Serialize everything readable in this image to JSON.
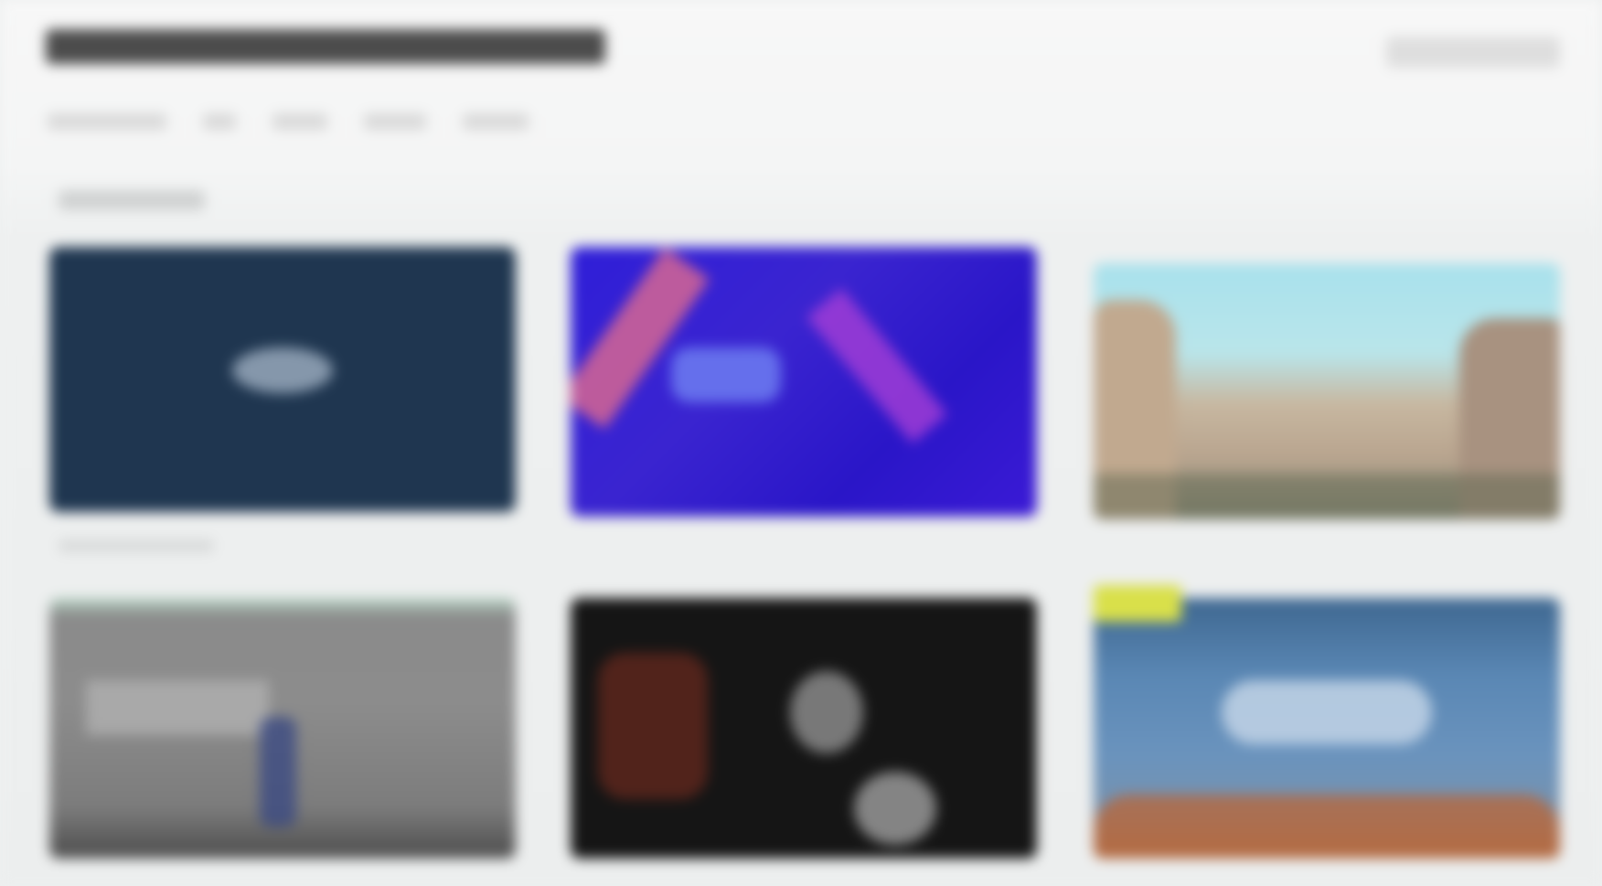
{
  "header": {
    "title": "",
    "action_label": ""
  },
  "tabs": [
    {
      "label": ""
    },
    {
      "label": ""
    },
    {
      "label": ""
    },
    {
      "label": ""
    },
    {
      "label": ""
    }
  ],
  "section": {
    "label": ""
  },
  "cards": [
    {
      "caption": "",
      "theme": "dark navy",
      "accent": "#1f3650"
    },
    {
      "caption": "",
      "theme": "vivid blue-purple",
      "accent": "#3a24d0"
    },
    {
      "caption": "",
      "theme": "coastal rocks and sky",
      "accent": "#a8e1ec"
    },
    {
      "caption": "",
      "theme": "grey street",
      "accent": "#8c8c8c"
    },
    {
      "caption": "",
      "theme": "dark night",
      "accent": "#151515"
    },
    {
      "caption": "",
      "theme": "blue sky with red rocks",
      "accent": "#5a87b4",
      "badge": ""
    }
  ],
  "colors": {
    "page_bg": "#eef0f0",
    "title_text": "#3d3d3d",
    "badge": "#d9e04a"
  }
}
